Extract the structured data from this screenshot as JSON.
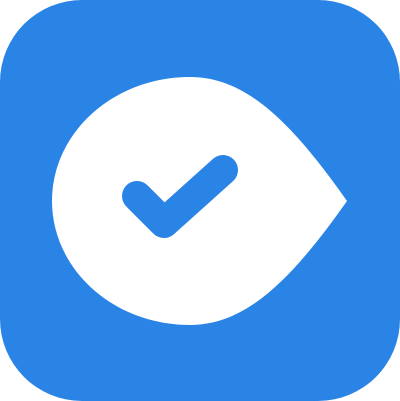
{
  "icon": {
    "name": "checkmark-drop-app-icon",
    "colors": {
      "background": "#2A84E6",
      "drop": "#FFFFFF",
      "check": "#2A84E6"
    }
  }
}
